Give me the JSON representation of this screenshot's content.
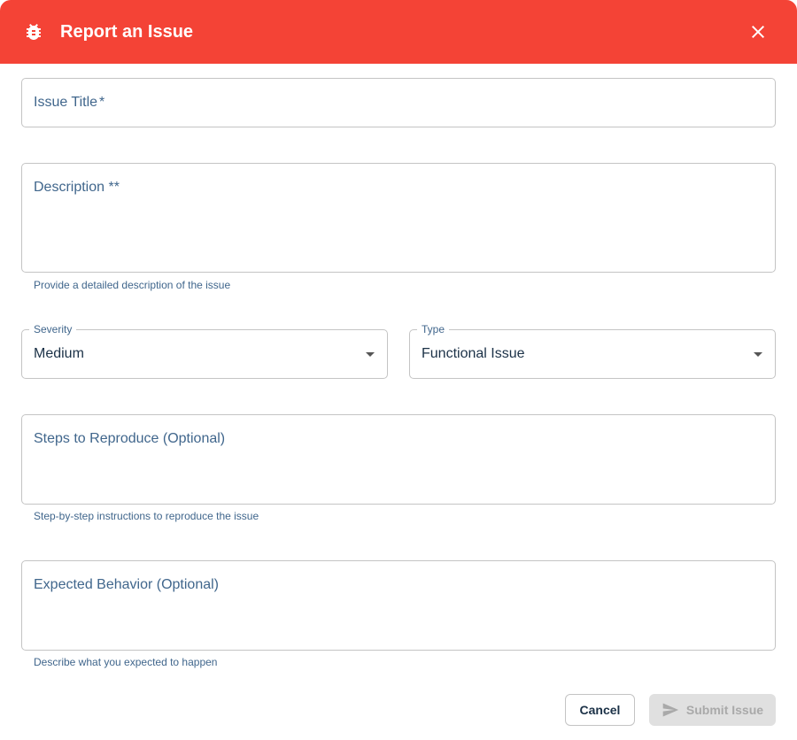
{
  "header": {
    "title": "Report an Issue",
    "icon": "bug-icon",
    "close_icon": "close-icon",
    "color": "#f44336"
  },
  "form": {
    "issue_title": {
      "placeholder": "Issue Title",
      "required_mark": "*"
    },
    "description": {
      "placeholder": "Description *",
      "required_mark": "*",
      "helper": "Provide a detailed description of the issue"
    },
    "severity": {
      "label": "Severity",
      "value": "Medium"
    },
    "type": {
      "label": "Type",
      "value": "Functional Issue"
    },
    "steps": {
      "placeholder": "Steps to Reproduce (Optional)",
      "helper": "Step-by-step instructions to reproduce the issue"
    },
    "expected": {
      "placeholder": "Expected Behavior (Optional)",
      "helper": "Describe what you expected to happen"
    }
  },
  "actions": {
    "cancel_label": "Cancel",
    "submit_label": "Submit Issue",
    "submit_icon": "send-icon"
  }
}
